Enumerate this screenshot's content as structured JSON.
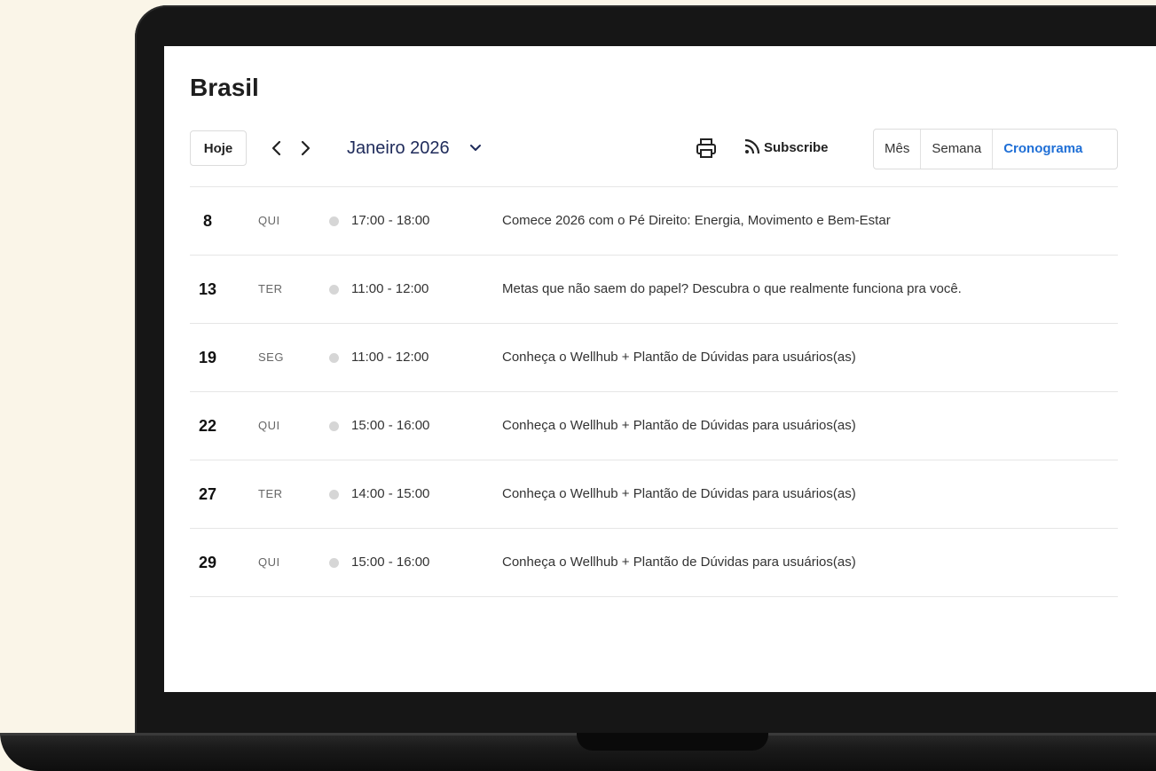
{
  "page_title": "Brasil",
  "toolbar": {
    "today_label": "Hoje",
    "prev_label": "‹",
    "next_label": "›",
    "month_label": "Janeiro 2026",
    "month_chevron": "⌄",
    "print_icon": "printer-icon",
    "subscribe_label": "Subscribe",
    "subscribe_icon": "rss-icon"
  },
  "views": [
    {
      "label": "Mês",
      "active": false
    },
    {
      "label": "Semana",
      "active": false
    },
    {
      "label": "Cronograma",
      "active": true
    }
  ],
  "accent_color": "#1f6fd6",
  "events": [
    {
      "day": "8",
      "dow": "QUI",
      "time": "17:00 - 18:00",
      "title": "Comece 2026 com o Pé Direito: Energia, Movimento e Bem-Estar"
    },
    {
      "day": "13",
      "dow": "TER",
      "time": "11:00 - 12:00",
      "title": "Metas que não saem do papel? Descubra o que realmente funciona pra você."
    },
    {
      "day": "19",
      "dow": "SEG",
      "time": "11:00 - 12:00",
      "title": "Conheça o Wellhub + Plantão de Dúvidas para usuários(as)"
    },
    {
      "day": "22",
      "dow": "QUI",
      "time": "15:00 - 16:00",
      "title": "Conheça o Wellhub + Plantão de Dúvidas para usuários(as)"
    },
    {
      "day": "27",
      "dow": "TER",
      "time": "14:00 - 15:00",
      "title": "Conheça o Wellhub + Plantão de Dúvidas para usuários(as)"
    },
    {
      "day": "29",
      "dow": "QUI",
      "time": "15:00 - 16:00",
      "title": "Conheça o Wellhub + Plantão de Dúvidas para usuários(as)"
    }
  ]
}
